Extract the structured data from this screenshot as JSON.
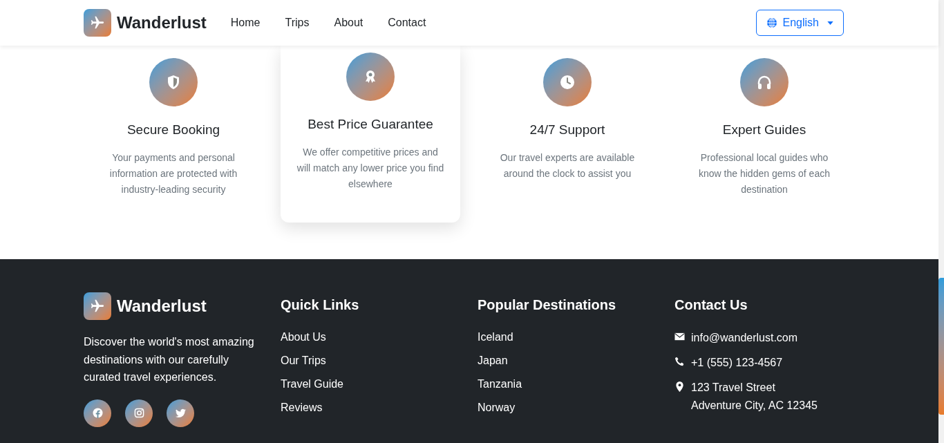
{
  "navbar": {
    "brand": "Wanderlust",
    "links": [
      "Home",
      "Trips",
      "About",
      "Contact"
    ],
    "language_button": "English"
  },
  "features": [
    {
      "title": "Secure Booking",
      "text": "Your payments and personal information are protected with industry-leading security",
      "raised": false
    },
    {
      "title": "Best Price Guarantee",
      "text": "We offer competitive prices and will match any lower price you find elsewhere",
      "raised": true
    },
    {
      "title": "24/7 Support",
      "text": "Our travel experts are available around the clock to assist you",
      "raised": false
    },
    {
      "title": "Expert Guides",
      "text": "Professional local guides who know the hidden gems of each destination",
      "raised": false
    }
  ],
  "footer": {
    "brand": "Wanderlust",
    "description": "Discover the world's most amazing destinations with our carefully curated travel experiences.",
    "social": [
      {
        "kind": "facebook"
      },
      {
        "kind": "instagram"
      },
      {
        "kind": "twitter"
      }
    ],
    "quick_links": {
      "title": "Quick Links",
      "items": [
        "About Us",
        "Our Trips",
        "Travel Guide",
        "Reviews"
      ]
    },
    "destinations": {
      "title": "Popular Destinations",
      "items": [
        "Iceland",
        "Japan",
        "Tanzania",
        "Norway"
      ]
    },
    "contact": {
      "title": "Contact Us",
      "items": [
        {
          "kind": "email",
          "lines": [
            "info@wanderlust.com"
          ]
        },
        {
          "kind": "phone",
          "lines": [
            "+1 (555) 123-4567"
          ]
        },
        {
          "kind": "address",
          "lines": [
            "123 Travel Street",
            "Adventure City, AC 12345"
          ]
        }
      ]
    }
  }
}
